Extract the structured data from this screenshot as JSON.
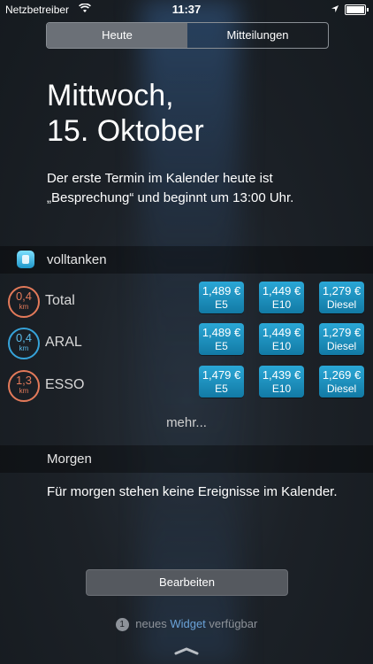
{
  "statusbar": {
    "carrier": "Netzbetreiber",
    "time": "11:37"
  },
  "tabs": [
    {
      "label": "Heute",
      "active": true
    },
    {
      "label": "Mitteilungen",
      "active": false
    }
  ],
  "date": {
    "line1": "Mittwoch,",
    "line2": "15. Oktober"
  },
  "summary": "Der erste Termin im Kalender heute ist „Besprechung“ und beginnt um 13:00 Uhr.",
  "widget": {
    "name": "volltanken",
    "stations": [
      {
        "name": "Total",
        "distance": "0,4",
        "unit": "km",
        "ring": "orange",
        "prices": [
          {
            "value": "1,489 €",
            "type": "E5"
          },
          {
            "value": "1,449 €",
            "type": "E10"
          },
          {
            "value": "1,279 €",
            "type": "Diesel"
          }
        ]
      },
      {
        "name": "ARAL",
        "distance": "0,4",
        "unit": "km",
        "ring": "blue",
        "prices": [
          {
            "value": "1,489 €",
            "type": "E5"
          },
          {
            "value": "1,449 €",
            "type": "E10"
          },
          {
            "value": "1,279 €",
            "type": "Diesel"
          }
        ]
      },
      {
        "name": "ESSO",
        "distance": "1,3",
        "unit": "km",
        "ring": "orange",
        "prices": [
          {
            "value": "1,479 €",
            "type": "E5"
          },
          {
            "value": "1,439 €",
            "type": "E10"
          },
          {
            "value": "1,269 €",
            "type": "Diesel"
          }
        ]
      }
    ],
    "more": "mehr..."
  },
  "tomorrow": {
    "title": "Morgen",
    "text": "Für morgen stehen keine Ereignisse im Kalender."
  },
  "footer": {
    "edit_label": "Bearbeiten",
    "badge": "1",
    "prefix": "neues",
    "link": "Widget",
    "suffix": "verfügbar"
  },
  "colors": {
    "price_bg": "#1e90c2",
    "ring_orange": "#e37a5a",
    "ring_blue": "#36a3d9",
    "link": "#6aa2d8"
  }
}
